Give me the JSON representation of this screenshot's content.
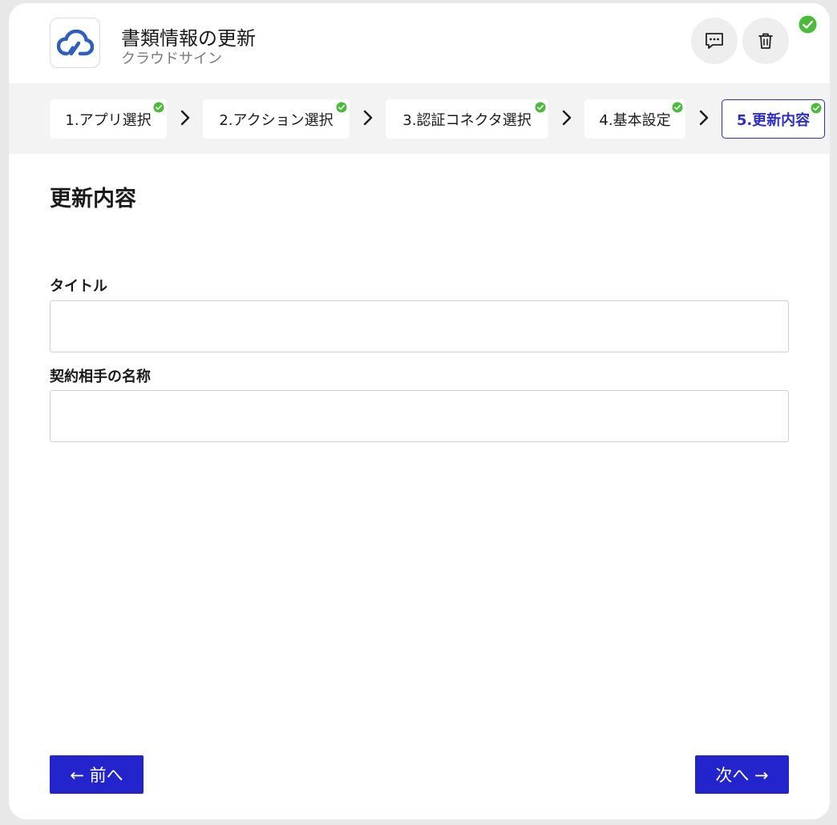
{
  "header": {
    "title": "書類情報の更新",
    "subtitle": "クラウドサイン",
    "app_icon": "cloudsign-cloud-icon",
    "actions": [
      {
        "name": "comment",
        "icon": "comment-icon"
      },
      {
        "name": "delete",
        "icon": "trash-icon"
      }
    ],
    "status_icon": "check-circle-icon"
  },
  "steps": [
    {
      "label": "1.アプリ選択",
      "completed": true,
      "active": false
    },
    {
      "label": "2.アクション選択",
      "completed": true,
      "active": false
    },
    {
      "label": "3.認証コネクタ選択",
      "completed": true,
      "active": false
    },
    {
      "label": "4.基本設定",
      "completed": true,
      "active": false
    },
    {
      "label": "5.更新内容",
      "completed": true,
      "active": true
    }
  ],
  "section": {
    "title": "更新内容"
  },
  "fields": [
    {
      "label": "タイトル",
      "value": ""
    },
    {
      "label": "契約相手の名称",
      "value": ""
    }
  ],
  "footer": {
    "prev_label": "← 前へ",
    "next_label": "次へ →"
  },
  "colors": {
    "accent": "#2424cc",
    "success": "#4cbb3c",
    "brand": "#2e5fbf"
  }
}
